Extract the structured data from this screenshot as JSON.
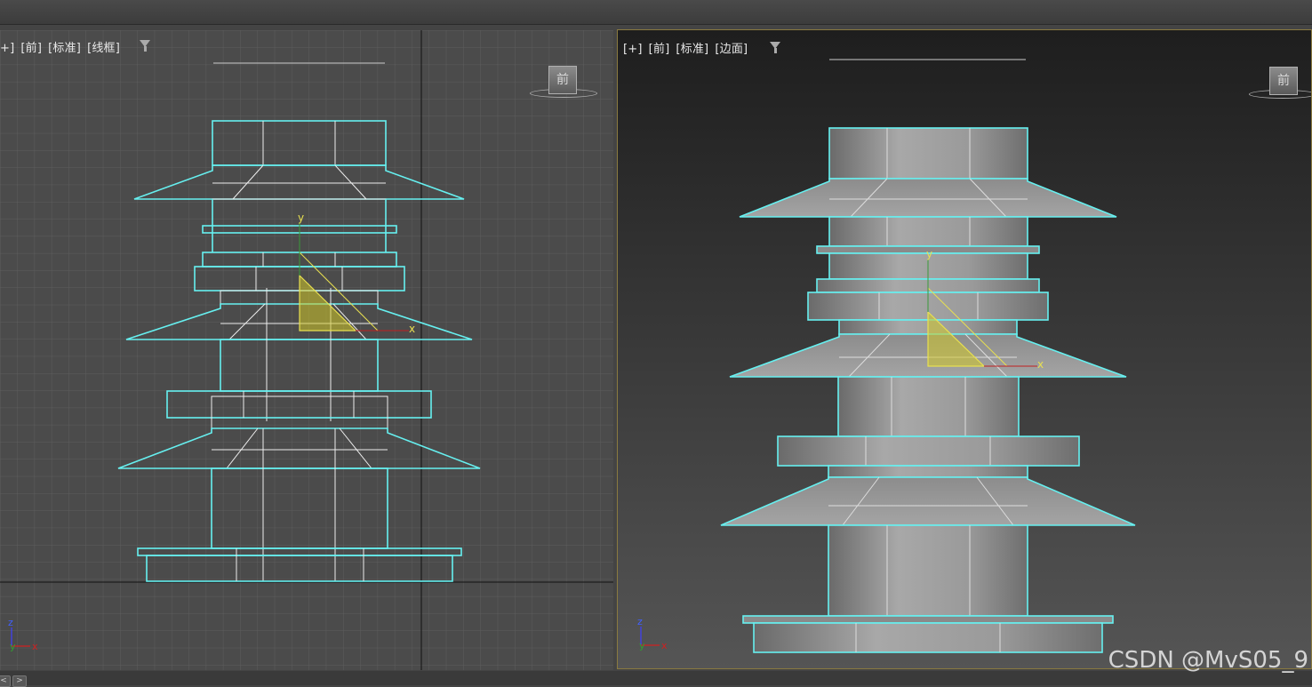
{
  "viewport_left": {
    "labels": [
      "+]",
      "[前]",
      "[标准]",
      "[线框]"
    ],
    "viewcube_label": "前",
    "axis_labels": {
      "x": "x",
      "y": "y",
      "z": "z"
    }
  },
  "viewport_right": {
    "labels": [
      "[+]",
      "[前]",
      "[标准]",
      "[边面]"
    ],
    "viewcube_label": "前",
    "axis_labels": {
      "x": "x",
      "y": "y",
      "z": "z"
    }
  },
  "icons": {
    "filter": "filter-icon",
    "viewcube": "viewcube-icon",
    "gizmo": "axis-gizmo-icon"
  },
  "colors": {
    "selection": "#66f0f0",
    "light_gizmo": "#e8e050",
    "grid": "#5c5c5c",
    "active_border": "#8a7a40"
  },
  "bottom": {
    "prev": "<",
    "next": ">"
  },
  "watermark": "CSDN @MvS05_9"
}
